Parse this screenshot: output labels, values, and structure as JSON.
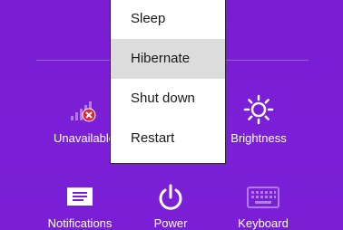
{
  "settings": {
    "network": {
      "label": "Unavailable",
      "icon": "network-unavailable-icon"
    },
    "brightness": {
      "label": "Brightness",
      "icon": "brightness-icon"
    },
    "notifications": {
      "label": "Notifications",
      "icon": "notifications-icon"
    },
    "power": {
      "label": "Power",
      "icon": "power-icon"
    },
    "keyboard": {
      "label": "Keyboard",
      "icon": "keyboard-icon"
    }
  },
  "power_menu": {
    "items": [
      {
        "label": "Sleep",
        "selected": false
      },
      {
        "label": "Hibernate",
        "selected": true
      },
      {
        "label": "Shut down",
        "selected": false
      },
      {
        "label": "Restart",
        "selected": false
      }
    ]
  },
  "colors": {
    "background": "#7b1fd6",
    "menu_background": "#ffffff",
    "menu_selected": "#dcdcdc",
    "error_badge": "#d9283b"
  }
}
